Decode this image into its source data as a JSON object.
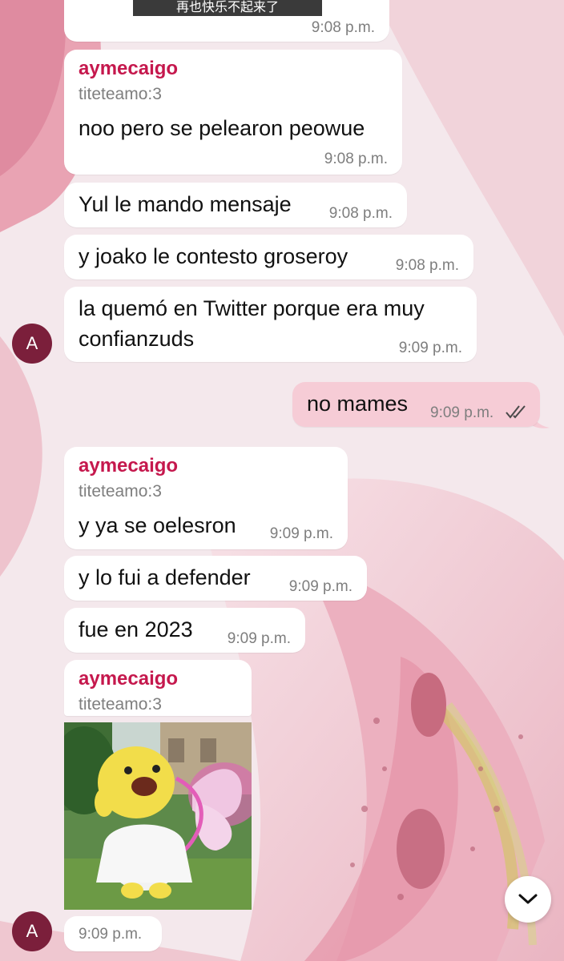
{
  "top_message": {
    "caption": "再也快乐不起来了",
    "time": "9:08 p.m."
  },
  "messages": [
    {
      "sender": "aymecaigo",
      "reply_to": "titeteamo:3",
      "text": "noo pero se pelearon peowue",
      "time": "9:08 p.m."
    },
    {
      "text": "Yul le mando mensaje",
      "time": "9:08 p.m."
    },
    {
      "text": "y joako le contesto groseroy",
      "time": "9:08 p.m."
    },
    {
      "text_line1": "la quemó en Twitter porque era muy",
      "text_line2": "confianzuds",
      "time": "9:09 p.m.",
      "avatar": "A"
    },
    {
      "outgoing": true,
      "text": "no mames",
      "time": "9:09 p.m.",
      "status_icon": "double-check-icon"
    },
    {
      "sender": "aymecaigo",
      "reply_to": "titeteamo:3",
      "text": "y ya se oelesron",
      "time": "9:09 p.m."
    },
    {
      "text": "y lo fui a defender",
      "time": "9:09 p.m."
    },
    {
      "text": "fue en 2023",
      "time": "9:09 p.m."
    },
    {
      "sender": "aymecaigo",
      "reply_to": "titeteamo:3",
      "sticker": "cupid-chick-sticker",
      "time": "9:09 p.m.",
      "avatar": "A"
    }
  ],
  "colors": {
    "sender": "#c5184d",
    "outgoing_bubble": "#f6ccd6",
    "avatar": "#7b1f3b",
    "read_check": "#4a4a4a"
  },
  "scroll_button_icon": "chevron-down-icon"
}
